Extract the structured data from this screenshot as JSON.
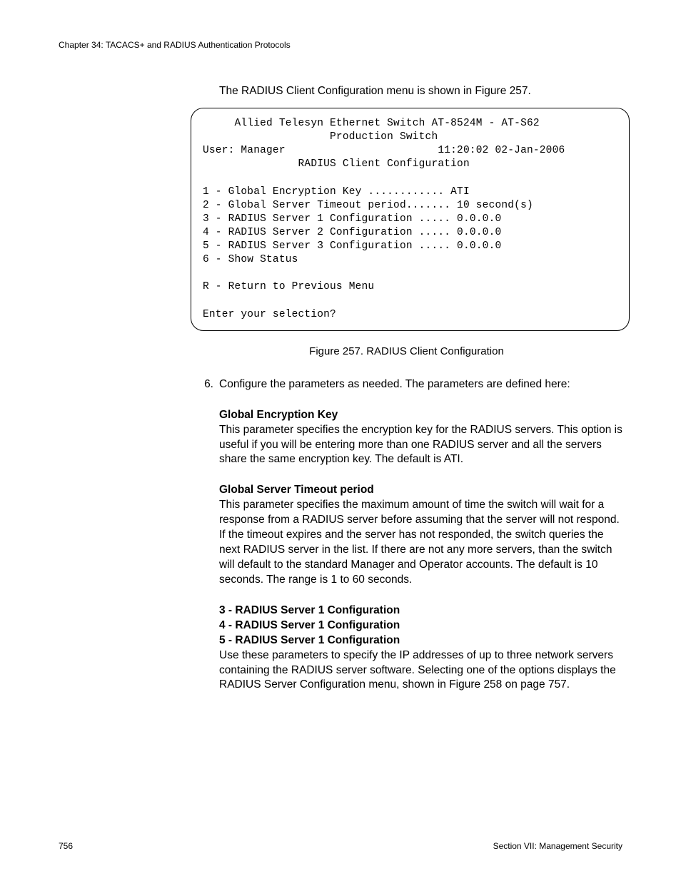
{
  "header": {
    "chapter_line": "Chapter 34: TACACS+ and RADIUS Authentication Protocols"
  },
  "intro": "The RADIUS Client Configuration menu is shown in Figure 257.",
  "terminal": {
    "line1": "     Allied Telesyn Ethernet Switch AT-8524M - AT-S62",
    "line2": "                    Production Switch",
    "line3": "User: Manager                        11:20:02 02-Jan-2006",
    "line4": "               RADIUS Client Configuration",
    "blank1": "",
    "line5": "1 - Global Encryption Key ............ ATI",
    "line6": "2 - Global Server Timeout period....... 10 second(s)",
    "line7": "3 - RADIUS Server 1 Configuration ..... 0.0.0.0",
    "line8": "4 - RADIUS Server 2 Configuration ..... 0.0.0.0",
    "line9": "5 - RADIUS Server 3 Configuration ..... 0.0.0.0",
    "line10": "6 - Show Status",
    "blank2": "",
    "line11": "R - Return to Previous Menu",
    "blank3": "",
    "line12": "Enter your selection?"
  },
  "figure_caption": "Figure 257. RADIUS Client Configuration",
  "step": {
    "number": "6.",
    "text": "Configure the parameters as needed. The parameters are defined here:"
  },
  "params": {
    "p1": {
      "title": "Global Encryption Key",
      "body": "This parameter specifies the encryption key for the RADIUS servers. This option is useful if you will be entering more than one RADIUS server and all the servers share the same encryption key. The default is ATI."
    },
    "p2": {
      "title": "Global Server Timeout period",
      "body": "This parameter specifies the maximum amount of time the switch will wait for a response from a RADIUS server before assuming that the server will not respond. If the timeout expires and the server has not responded, the switch queries the next RADIUS server in the list. If there are not any more servers, than the switch will default to the standard Manager and Operator accounts. The default is 10 seconds. The range is 1 to 60 seconds."
    },
    "p3": {
      "title1": "3 - RADIUS Server 1 Configuration",
      "title2": "4 - RADIUS Server 1 Configuration",
      "title3": "5 - RADIUS Server 1 Configuration",
      "body": "Use these parameters to specify the IP addresses of up to three network servers containing the RADIUS server software. Selecting one of the options displays the RADIUS Server Configuration menu, shown in Figure 258 on page 757."
    }
  },
  "footer": {
    "page_number": "756",
    "section": "Section VII: Management Security"
  }
}
